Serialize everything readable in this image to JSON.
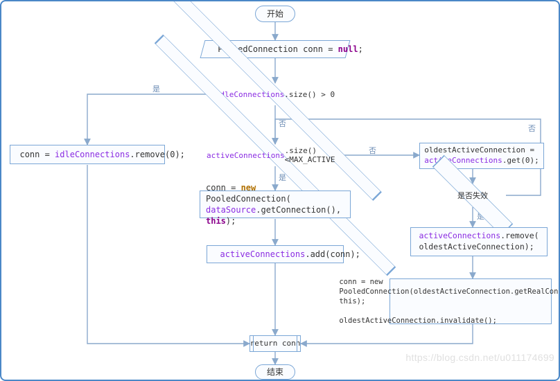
{
  "terminal_start": "开始",
  "terminal_end": "结束",
  "process_init": {
    "pre": "PooledConnection conn = ",
    "kw": "null",
    "post": ";"
  },
  "decision_idle": {
    "field": "idleConnections",
    "post": ".size() > 0"
  },
  "decision_active": {
    "field": "activeConnections",
    "post": ".size()<MAX_ACTIVE"
  },
  "proc_remove_idle": {
    "pre": "conn = ",
    "field": "idleConnections",
    "post": ".remove(0);"
  },
  "proc_new_conn_l1": {
    "pre": "conn = ",
    "kw_new": "new",
    "post": " PooledConnection("
  },
  "proc_new_conn_l2": {
    "field": "dataSource",
    "mid": ".getConnection(), ",
    "kw_this": "this",
    "post": ");"
  },
  "proc_add_active": {
    "field": "activeConnections",
    "post": ".add(conn);"
  },
  "proc_oldest_assign_l1": "oldestActiveConnection =",
  "proc_oldest_assign_l2": {
    "field": "activeConnections",
    "post": ".get(0);"
  },
  "decision_expired": "是否失效",
  "proc_remove_active_l1": {
    "field": "activeConnections",
    "post": ".remove("
  },
  "proc_remove_active_l2": "oldestActiveConnection);",
  "proc_recycle": "conn = new\nPooledConnection(oldestActiveConnection.getRealConnection(), this);\n\noldestActiveConnection.invalidate();",
  "subproc_return": "return conn",
  "label_yes": "是",
  "label_no": "否",
  "watermark": "https://blog.csdn.net/u011174699",
  "chart_data": {
    "type": "flowchart",
    "nodes": [
      {
        "id": "start",
        "type": "terminal",
        "text": "开始"
      },
      {
        "id": "init",
        "type": "io",
        "text": "PooledConnection conn = null;"
      },
      {
        "id": "d_idle",
        "type": "decision",
        "text": "idleConnections.size() > 0"
      },
      {
        "id": "p_remove",
        "type": "process",
        "text": "conn = idleConnections.remove(0);"
      },
      {
        "id": "d_active",
        "type": "decision",
        "text": "activeConnections.size()<MAX_ACTIVE"
      },
      {
        "id": "p_newc",
        "type": "process",
        "text": "conn = new PooledConnection(dataSource.getConnection(), this);"
      },
      {
        "id": "p_add",
        "type": "process",
        "text": "activeConnections.add(conn);"
      },
      {
        "id": "p_oldest",
        "type": "process",
        "text": "oldestActiveConnection = activeConnections.get(0);"
      },
      {
        "id": "d_valid",
        "type": "decision",
        "text": "是否失效"
      },
      {
        "id": "p_rmact",
        "type": "process",
        "text": "activeConnections.remove(oldestActiveConnection);"
      },
      {
        "id": "p_recyc",
        "type": "process",
        "text": "conn = new PooledConnection(oldestActiveConnection.getRealConnection(), this); oldestActiveConnection.invalidate();"
      },
      {
        "id": "ret",
        "type": "subroutine",
        "text": "return conn"
      },
      {
        "id": "end",
        "type": "terminal",
        "text": "结束"
      }
    ],
    "edges": [
      {
        "from": "start",
        "to": "init"
      },
      {
        "from": "init",
        "to": "d_idle"
      },
      {
        "from": "d_idle",
        "to": "p_remove",
        "label": "是"
      },
      {
        "from": "d_idle",
        "to": "d_active",
        "label": "否"
      },
      {
        "from": "p_remove",
        "to": "ret"
      },
      {
        "from": "d_active",
        "to": "p_newc",
        "label": "是"
      },
      {
        "from": "d_active",
        "to": "p_oldest",
        "label": "否"
      },
      {
        "from": "p_newc",
        "to": "p_add"
      },
      {
        "from": "p_add",
        "to": "ret"
      },
      {
        "from": "p_oldest",
        "to": "d_valid"
      },
      {
        "from": "d_valid",
        "to": "p_rmact",
        "label": "是"
      },
      {
        "from": "d_valid",
        "to": "d_active",
        "label": "否"
      },
      {
        "from": "p_rmact",
        "to": "p_recyc"
      },
      {
        "from": "p_recyc",
        "to": "ret"
      },
      {
        "from": "ret",
        "to": "end"
      }
    ]
  }
}
